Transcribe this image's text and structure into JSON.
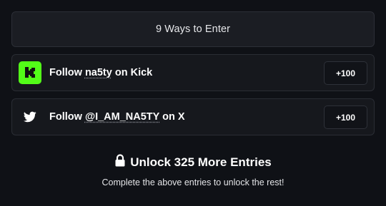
{
  "header": {
    "title": "9 Ways to Enter"
  },
  "entries": [
    {
      "icon": "kick-logo-icon",
      "prefix": "Follow ",
      "handle": "na5ty",
      "suffix": " on Kick",
      "points": "+100",
      "icon_color": "#53fc18"
    },
    {
      "icon": "twitter-bird-icon",
      "prefix": "Follow ",
      "handle": "@I_AM_NA5TY",
      "suffix": " on X",
      "points": "+100"
    }
  ],
  "unlock": {
    "icon": "lock-icon",
    "title": "Unlock 325 More Entries",
    "subtitle": "Complete the above entries to unlock the rest!"
  }
}
